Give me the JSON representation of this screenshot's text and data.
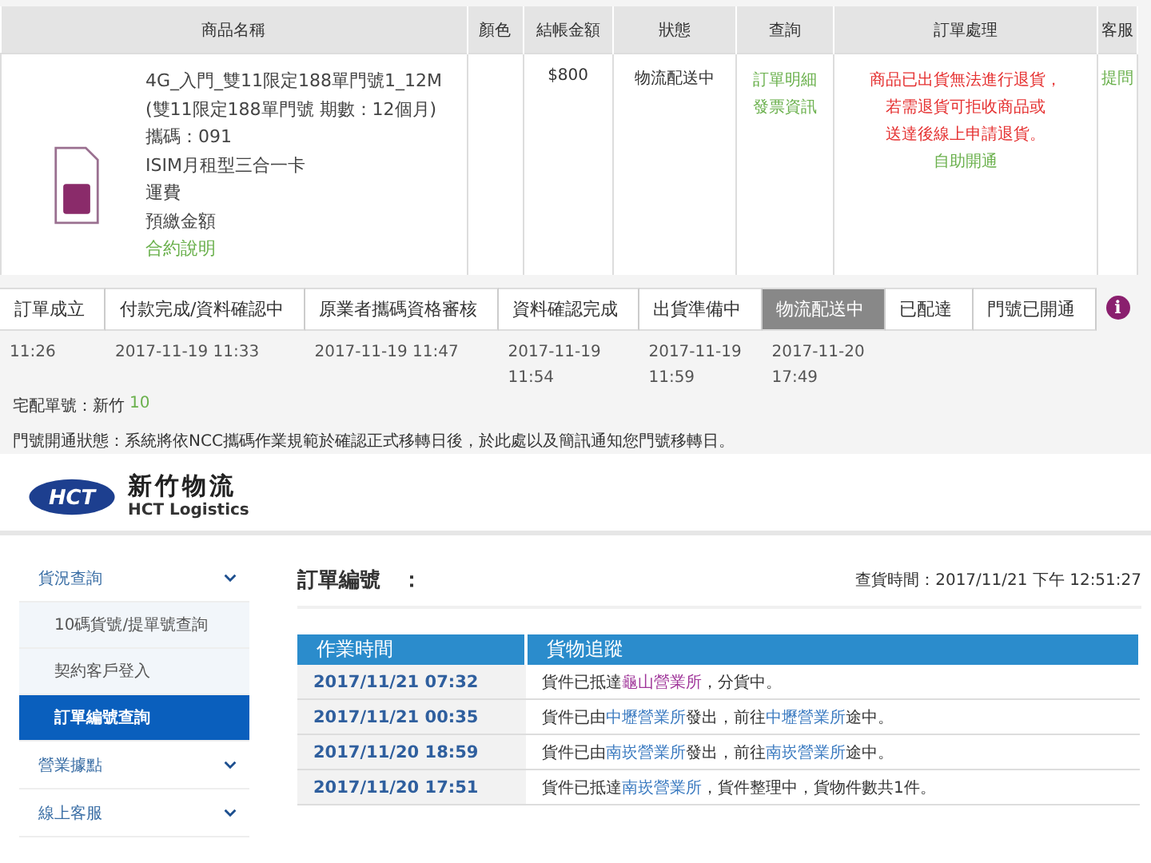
{
  "order_table": {
    "columns": [
      "商品名稱",
      "顏色",
      "結帳金額",
      "狀態",
      "查詢",
      "訂單處理",
      "客服"
    ],
    "product": {
      "lines": [
        "4G_入門_雙11限定188單門號1_12M",
        "(雙11限定188單門號 期數：12個月)",
        "攜碼：091",
        "ISIM月租型三合一卡",
        "運費",
        "預繳金額"
      ],
      "link": "合約說明"
    },
    "amount": "$800",
    "status": "物流配送中",
    "queries": [
      "訂單明細",
      "發票資訊"
    ],
    "processing": {
      "notice": [
        "商品已出貨無法進行退貨，",
        "若需退貨可拒收商品或",
        "送達後線上申請退貨。"
      ],
      "link": "自助開通"
    },
    "service": "提問"
  },
  "progress": {
    "steps": [
      {
        "label": "訂單成立",
        "selected": false,
        "time": "11:26"
      },
      {
        "label": "付款完成/資料確認中",
        "selected": false,
        "date": "2017-11-19 11:33"
      },
      {
        "label": "原業者攜碼資格審核",
        "selected": false,
        "date": "2017-11-19 11:47"
      },
      {
        "label": "資料確認完成",
        "selected": false,
        "date": "2017-11-19",
        "time": "11:54"
      },
      {
        "label": "出貨準備中",
        "selected": false,
        "date": "2017-11-19",
        "time": "11:59"
      },
      {
        "label": "物流配送中",
        "selected": true,
        "date": "2017-11-20",
        "time": "17:49"
      },
      {
        "label": "已配達",
        "selected": false
      },
      {
        "label": "門號已開通",
        "selected": false
      }
    ],
    "info": "i",
    "delivery_label": "宅配單號：新竹",
    "delivery_number": "10",
    "activation_note": "門號開通狀態：系統將依NCC攜碼作業規範於確認正式移轉日後，於此處以及簡訊通知您門號移轉日。"
  },
  "hct": {
    "logo_text": "HCT",
    "name": "新竹物流",
    "name_en": "HCT Logistics",
    "sidebar": [
      {
        "label": "貨況查詢",
        "kind": "group",
        "selected": false
      },
      {
        "label": "10碼貨號/提單號查詢",
        "kind": "sub",
        "selected": false
      },
      {
        "label": "契約客戶登入",
        "kind": "sub",
        "selected": false
      },
      {
        "label": "訂單編號查詢",
        "kind": "sub",
        "selected": true
      },
      {
        "label": "營業據點",
        "kind": "group",
        "selected": false
      },
      {
        "label": "線上客服",
        "kind": "group",
        "selected": false
      }
    ],
    "order_label": "訂單編號　：",
    "query_time": "查貨時間：2017/11/21 下午 12:51:27",
    "columns": [
      "作業時間",
      "貨物追蹤"
    ],
    "rows": [
      {
        "time": "2017/11/21 07:32",
        "parts": [
          {
            "kind": "text",
            "text": "貨件已抵達"
          },
          {
            "kind": "visited",
            "text": "龜山營業所"
          },
          {
            "kind": "text",
            "text": "，分貨中。"
          }
        ]
      },
      {
        "time": "2017/11/21 00:35",
        "parts": [
          {
            "kind": "text",
            "text": "貨件已由"
          },
          {
            "kind": "link",
            "text": "中壢營業所"
          },
          {
            "kind": "text",
            "text": "發出，前往"
          },
          {
            "kind": "link",
            "text": "中壢營業所"
          },
          {
            "kind": "text",
            "text": "途中。"
          }
        ]
      },
      {
        "time": "2017/11/20 18:59",
        "parts": [
          {
            "kind": "text",
            "text": "貨件已由"
          },
          {
            "kind": "link",
            "text": "南崁營業所"
          },
          {
            "kind": "text",
            "text": "發出，前往"
          },
          {
            "kind": "link",
            "text": "南崁營業所"
          },
          {
            "kind": "text",
            "text": "途中。"
          }
        ]
      },
      {
        "time": "2017/11/20 17:51",
        "parts": [
          {
            "kind": "text",
            "text": "貨件已抵達"
          },
          {
            "kind": "link",
            "text": "南崁營業所"
          },
          {
            "kind": "text",
            "text": "，貨件整理中，貨物件數共1件。"
          }
        ]
      }
    ]
  }
}
